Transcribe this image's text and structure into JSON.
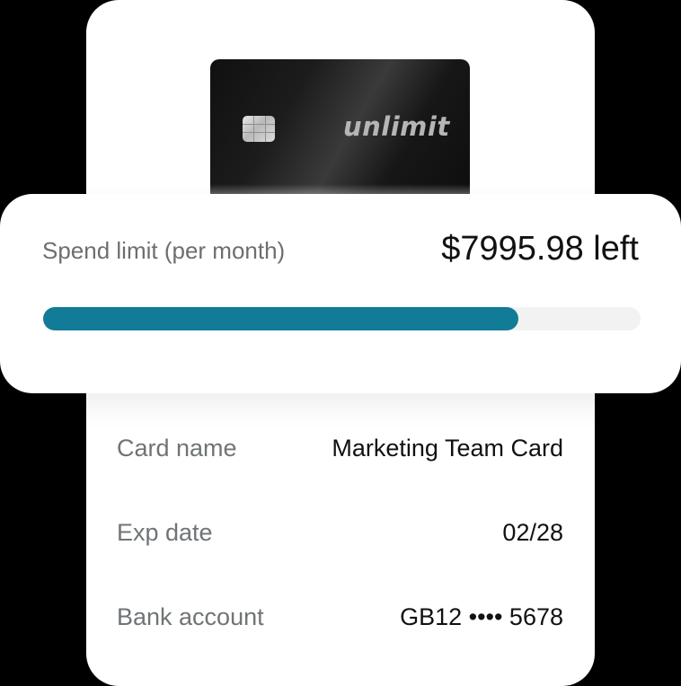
{
  "card": {
    "brand": "unlimit"
  },
  "spend": {
    "label": "Spend limit (per month)",
    "remaining": "$7995.98 left",
    "progress_fraction": 0.795,
    "accent_color": "#127c98",
    "track_color": "#f2f2f2"
  },
  "details": [
    {
      "label": "Card name",
      "value": "Marketing Team Card"
    },
    {
      "label": "Exp date",
      "value": "02/28"
    },
    {
      "label": "Bank account",
      "value": "GB12 •••• 5678"
    }
  ]
}
